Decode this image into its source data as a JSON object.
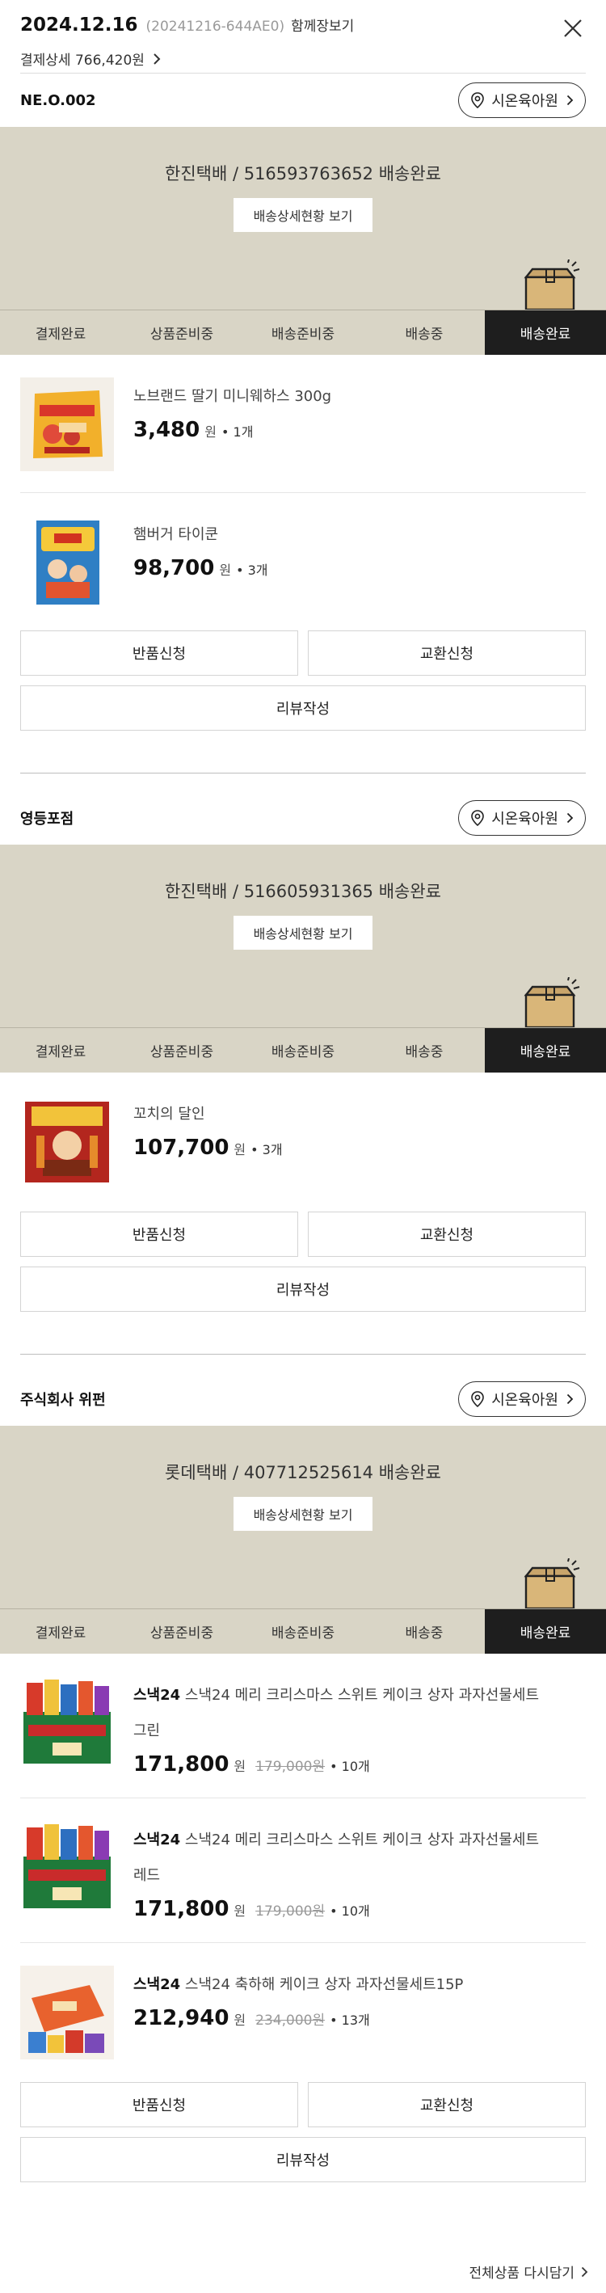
{
  "header": {
    "date": "2024.12.16",
    "order_no": "(20241216-644AE0)",
    "together": "함께장보기",
    "payment_detail": "결제상세 766,420원"
  },
  "steps": [
    "결제완료",
    "상품준비중",
    "배송준비중",
    "배송중",
    "배송완료"
  ],
  "store_button_label": "시온육아원",
  "track_button_label": "배송상세현황 보기",
  "action_buttons": {
    "return": "반품신청",
    "exchange": "교환신청",
    "review": "리뷰작성"
  },
  "sellers": [
    {
      "name": "NE.O.002",
      "delivery_text": "한진택배 / 516593763652 배송완료",
      "products": [
        {
          "name": "노브랜드 딸기 미니웨하스 300g",
          "price": "3,480",
          "won": "원",
          "original_price": "",
          "qty": "• 1개",
          "thumb": "wafer-thumbnail"
        },
        {
          "name": "햄버거 타이쿤",
          "price": "98,700",
          "won": "원",
          "original_price": "",
          "qty": "• 3개",
          "thumb": "board-game-thumbnail"
        }
      ]
    },
    {
      "name": "영등포점",
      "delivery_text": "한진택배 / 516605931365 배송완료",
      "products": [
        {
          "name": "꼬치의 달인",
          "price": "107,700",
          "won": "원",
          "original_price": "",
          "qty": "• 3개",
          "thumb": "skewer-game-thumbnail"
        }
      ]
    },
    {
      "name": "주식회사 위펀",
      "delivery_text": "롯데택배 / 407712525614 배송완료",
      "products": [
        {
          "brand": "스낵24",
          "name": "스낵24 메리 크리스마스 스위트 케이크 상자 과자선물세트",
          "name2": "그린",
          "price": "171,800",
          "won": "원",
          "original_price": "179,000원",
          "qty": "• 10개",
          "thumb": "snack-gift-green-thumbnail"
        },
        {
          "brand": "스낵24",
          "name": "스낵24 메리 크리스마스 스위트 케이크 상자 과자선물세트",
          "name2": "레드",
          "price": "171,800",
          "won": "원",
          "original_price": "179,000원",
          "qty": "• 10개",
          "thumb": "snack-gift-red-thumbnail"
        },
        {
          "brand": "스낵24",
          "name": "스낵24 축하해 케이크 상자 과자선물세트15P",
          "name2": "",
          "price": "212,940",
          "won": "원",
          "original_price": "234,000원",
          "qty": "• 13개",
          "thumb": "snack-cake-thumbnail"
        }
      ]
    }
  ],
  "footer": {
    "reorder_all": "전체상품 다시담기"
  }
}
